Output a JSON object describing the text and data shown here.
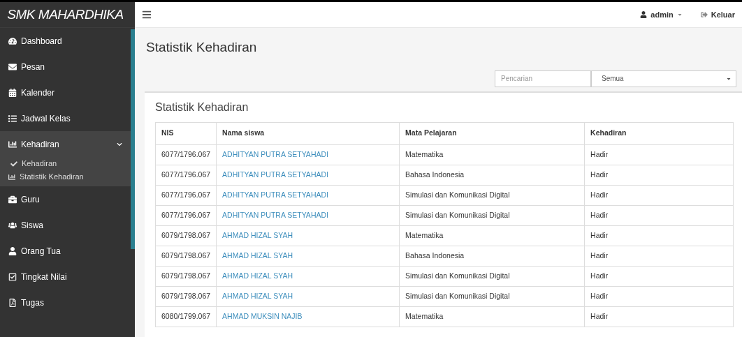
{
  "brand": "SMK MAHARDHIKA",
  "sidebar": {
    "items": [
      {
        "label": "Dashboard",
        "expanded": false
      },
      {
        "label": "Pesan",
        "expanded": false
      },
      {
        "label": "Kalender",
        "expanded": false
      },
      {
        "label": "Jadwal Kelas",
        "expanded": false
      },
      {
        "label": "Kehadiran",
        "expanded": true,
        "children": [
          {
            "label": "Kehadiran"
          },
          {
            "label": "Statistik Kehadiran"
          }
        ]
      },
      {
        "label": "Guru",
        "expanded": false
      },
      {
        "label": "Siswa",
        "expanded": false
      },
      {
        "label": "Orang Tua",
        "expanded": false
      },
      {
        "label": "Tingkat Nilai",
        "expanded": false
      },
      {
        "label": "Tugas",
        "expanded": false
      }
    ]
  },
  "topbar": {
    "user": "admin",
    "logout": "Keluar"
  },
  "page_title": "Statistik Kehadiran",
  "filters": {
    "search": {
      "placeholder": "Pencarian"
    },
    "select": {
      "value": "Semua"
    }
  },
  "card": {
    "title": "Statistik Kehadiran",
    "table": {
      "columns": [
        "NIS",
        "Nama siswa",
        "Mata Pelajaran",
        "Kehadiran"
      ],
      "rows": [
        [
          "6077/1796.067",
          "ADHITYAN PUTRA SETYAHADI",
          "Matematika",
          "Hadir"
        ],
        [
          "6077/1796.067",
          "ADHITYAN PUTRA SETYAHADI",
          "Bahasa Indonesia",
          "Hadir"
        ],
        [
          "6077/1796.067",
          "ADHITYAN PUTRA SETYAHADI",
          "Simulasi dan Komunikasi Digital",
          "Hadir"
        ],
        [
          "6077/1796.067",
          "ADHITYAN PUTRA SETYAHADI",
          "Simulasi dan Komunikasi Digital",
          "Hadir"
        ],
        [
          "6079/1798.067",
          "AHMAD HIZAL SYAH",
          "Matematika",
          "Hadir"
        ],
        [
          "6079/1798.067",
          "AHMAD HIZAL SYAH",
          "Bahasa Indonesia",
          "Hadir"
        ],
        [
          "6079/1798.067",
          "AHMAD HIZAL SYAH",
          "Simulasi dan Komunikasi Digital",
          "Hadir"
        ],
        [
          "6079/1798.067",
          "AHMAD HIZAL SYAH",
          "Simulasi dan Komunikasi Digital",
          "Hadir"
        ],
        [
          "6080/1799.067",
          "AHMAD MUKSIN NAJIB",
          "Matematika",
          "Hadir"
        ]
      ]
    }
  }
}
